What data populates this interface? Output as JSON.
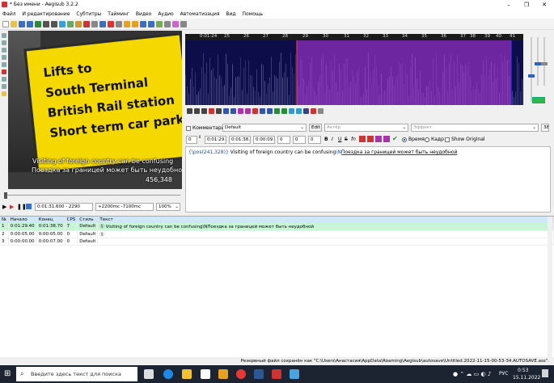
{
  "window": {
    "title": "* Без имени - Aegisub 3.2.2"
  },
  "menu": [
    "Файл",
    "И редактирование",
    "Субтитры",
    "Тайминг",
    "Видео",
    "Аудио",
    "Автоматизация",
    "Вид",
    "Помощь"
  ],
  "video": {
    "sign_lines": [
      "Lifts to",
      "South Terminal",
      "British Rail station",
      "Short term car park"
    ],
    "subtitle_en": "Visiting of foreign country can be confusing",
    "subtitle_ru": "Поездка за границей может быть неудобной",
    "coords": "456,348"
  },
  "video_controls": {
    "time": "0:01:31.600 - 2290",
    "offset": "+2200mc -7100mc",
    "zoom": "100%"
  },
  "audio": {
    "ruler_ticks": [
      "0:01:24",
      "25",
      "26",
      "27",
      "28",
      "29",
      "30",
      "31",
      "32",
      "33",
      "34",
      "35",
      "36",
      "37",
      "38",
      "39",
      "40",
      "41"
    ]
  },
  "edit": {
    "comment_label": "Комментарий",
    "style": "Default",
    "edit_button": "Edit",
    "actor_placeholder": "Актёр",
    "effect_placeholder": "Эффект",
    "char_count": "38",
    "layer": "0",
    "start": "0:01:29.40",
    "end": "0:01:38.70",
    "duration": "0:00:09.30",
    "margin_l": "0",
    "margin_r": "0",
    "margin_v": "0",
    "time_label": "Время",
    "frame_label": "Кадр",
    "show_original_label": "Show Original",
    "text_tag": "{\\pos(241,328)}",
    "text_en": " Visiting of foreign country can be confusing",
    "text_sep": "\\N",
    "text_ru": "Поездка за границей может быть неудобной"
  },
  "grid": {
    "headers": [
      "№",
      "Начало",
      "Конец",
      "CPS",
      "Стиль",
      "Текст"
    ],
    "rows": [
      [
        "1",
        "0:01:29.40",
        "0:01:38.70",
        "7",
        "Default",
        "Ⓢ Visiting of foreign country can be confusing\\NПоездка за границей может быть неудобной"
      ],
      [
        "2",
        "0:00:05.00",
        "0:00:05.00",
        "0",
        "Default",
        "Ⓢ"
      ],
      [
        "3",
        "0:00:00.00",
        "0:00:07.00",
        "0",
        "Default",
        ""
      ]
    ]
  },
  "status": {
    "text": "Резервный файл сохранён как \"C:\\Users\\Анастасия\\AppData\\Roaming\\Aegisub\\autosave\\Untitled.2022-11-15-00-53-34.AUTOSAVE.ass\"."
  },
  "taskbar": {
    "search_placeholder": "Введите здесь текст для поиска",
    "lang": "РУС",
    "time": "0:53",
    "date": "15.11.2022"
  },
  "colors": {
    "selection": "#be3ce6",
    "active_row": "#c8f5d8",
    "grid_header": "#cfe7f9",
    "audio_bg": "#0d0d4a"
  }
}
